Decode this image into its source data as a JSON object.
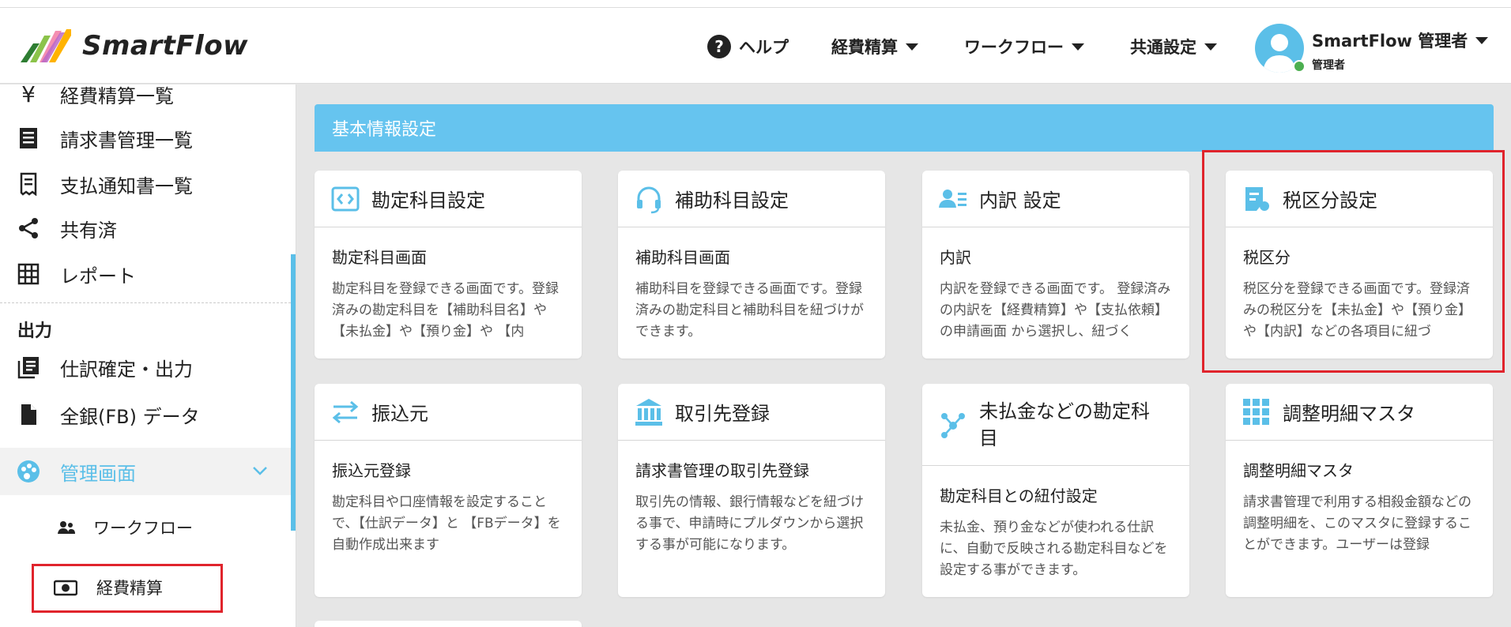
{
  "app": {
    "brand": "SmartFlow"
  },
  "header": {
    "help": "ヘルプ",
    "help_glyph": "?",
    "expense": "経費精算",
    "workflow": "ワークフロー",
    "common_settings": "共通設定",
    "user_name": "SmartFlow 管理者",
    "user_role": "管理者"
  },
  "sidebar": {
    "items": [
      {
        "label": "経費精算一覧",
        "icon": "yen-icon"
      },
      {
        "label": "請求書管理一覧",
        "icon": "invoice-icon"
      },
      {
        "label": "支払通知書一覧",
        "icon": "receipt-icon"
      },
      {
        "label": "共有済",
        "icon": "share-icon"
      },
      {
        "label": "レポート",
        "icon": "grid-icon"
      }
    ],
    "yen_glyph": "¥",
    "output_section": "出力",
    "output_items": [
      {
        "label": "仕訳確定・出力",
        "icon": "journal-icon"
      },
      {
        "label": "全銀(FB) データ",
        "icon": "file-icon"
      }
    ],
    "admin": "管理画面",
    "sub_items": [
      {
        "label": "ワークフロー",
        "icon": "people-icon"
      },
      {
        "label": "経費精算",
        "icon": "money-icon"
      }
    ]
  },
  "main": {
    "section_title": "基本情報設定",
    "cards": [
      {
        "title": "勘定科目設定",
        "sub": "勘定科目画面",
        "desc": "勘定科目を登録できる画面です。登録済みの勘定科目を【補助科目名】や【未払金】や【預り金】や 【内",
        "icon": "code-box-icon"
      },
      {
        "title": "補助科目設定",
        "sub": "補助科目画面",
        "desc": "補助科目を登録できる画面です。登録済みの勘定科目と補助科目を紐づけができます。",
        "icon": "headset-icon"
      },
      {
        "title": "内訳 設定",
        "sub": "内訳",
        "desc": "内訳を登録できる画面です。 登録済みの内訳を【経費精算】や【支払依頼】の申請画面 から選択し、紐づく",
        "icon": "contact-list-icon"
      },
      {
        "title": "税区分設定",
        "sub": "税区分",
        "desc": "税区分を登録できる画面です。登録済みの税区分を【未払金】や【預り金】や【内訳】などの各項目に紐づ",
        "icon": "tax-doc-icon"
      },
      {
        "title": "振込元",
        "sub": "振込元登録",
        "desc": "勘定科目や口座情報を設定することで、【仕訳データ】と 【FBデータ】を自動作成出来ます",
        "icon": "transfer-arrows-icon"
      },
      {
        "title": "取引先登録",
        "sub": "請求書管理の取引先登録",
        "desc": "取引先の情報、銀行情報などを紐づける事で、申請時にプルダウンから選択する事が可能になります。",
        "icon": "bank-icon"
      },
      {
        "title": "未払金などの勘定科目",
        "sub": "勘定科目との紐付設定",
        "desc": "未払金、預り金などが使われる仕訳に、自動で反映される勘定科目などを設定する事ができます。",
        "icon": "network-icon"
      },
      {
        "title": "調整明細マスタ",
        "sub": "調整明細マスタ",
        "desc": "請求書管理で利用する相殺金額などの調整明細を、このマスタに登録することができます。ユーザーは登録",
        "icon": "apps-grid-icon"
      }
    ]
  },
  "colors": {
    "accent": "#5bbfe8",
    "header_bar": "#66c4ef",
    "highlight": "#e0242c"
  }
}
